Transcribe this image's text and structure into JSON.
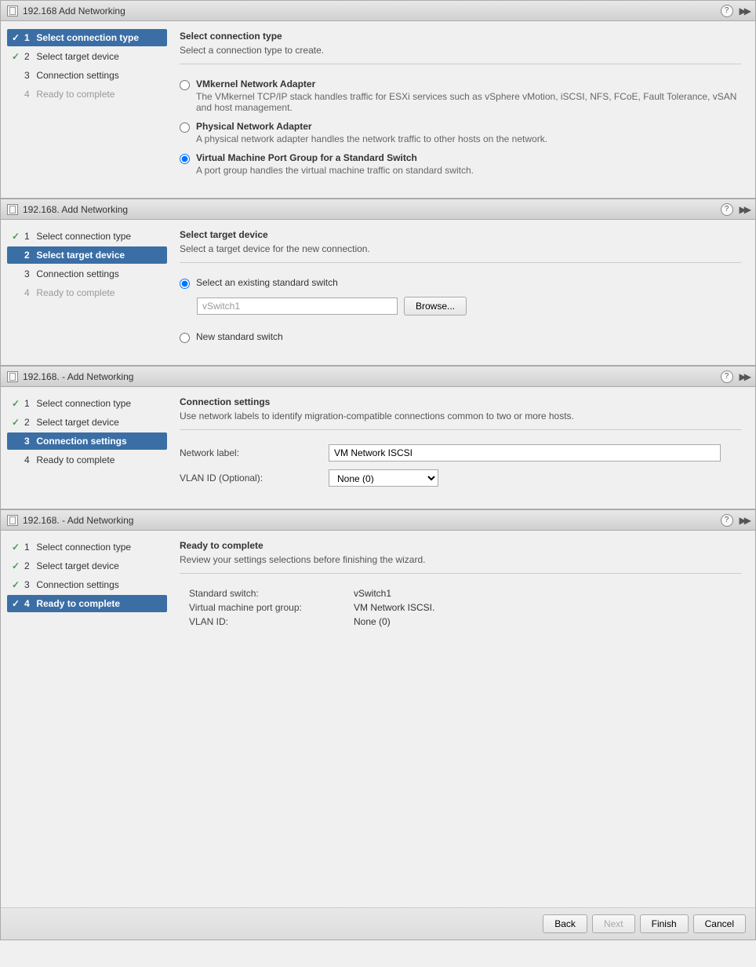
{
  "panels": [
    {
      "title": "192.168        Add Networking",
      "steps": {
        "s1": {
          "num": "1",
          "label": "Select connection type",
          "checked": true,
          "active": true
        },
        "s2": {
          "num": "2",
          "label": "Select target device",
          "checked": true,
          "active": false
        },
        "s3": {
          "num": "3",
          "label": "Connection settings",
          "checked": false,
          "active": false
        },
        "s4": {
          "num": "4",
          "label": "Ready to complete",
          "checked": false,
          "active": false,
          "dim": true
        }
      },
      "header": "Select connection type",
      "sub": "Select a connection type to create.",
      "options": {
        "o1": {
          "title": "VMkernel Network Adapter",
          "desc": "The VMkernel TCP/IP stack handles traffic for ESXi services such as vSphere vMotion, iSCSI, NFS, FCoE, Fault Tolerance, vSAN and host management."
        },
        "o2": {
          "title": "Physical Network Adapter",
          "desc": "A physical network adapter handles the network traffic to other hosts on the network."
        },
        "o3": {
          "title": "Virtual Machine Port Group for a Standard Switch",
          "desc": "A port group handles the virtual machine traffic on standard switch."
        }
      }
    },
    {
      "title": "192.168.        Add Networking",
      "steps": {
        "s1": {
          "num": "1",
          "label": "Select connection type",
          "checked": true
        },
        "s2": {
          "num": "2",
          "label": "Select target device",
          "active": true
        },
        "s3": {
          "num": "3",
          "label": "Connection settings"
        },
        "s4": {
          "num": "4",
          "label": "Ready to complete",
          "dim": true
        }
      },
      "header": "Select target device",
      "sub": "Select a target device for the new connection.",
      "options": {
        "o1": {
          "title": "Select an existing standard switch"
        },
        "o2": {
          "title": "New standard switch"
        }
      },
      "switch_value": "vSwitch1",
      "browse": "Browse..."
    },
    {
      "title": "192.168.      - Add Networking",
      "steps": {
        "s1": {
          "num": "1",
          "label": "Select connection type",
          "checked": true
        },
        "s2": {
          "num": "2",
          "label": "Select target device",
          "checked": true
        },
        "s3": {
          "num": "3",
          "label": "Connection settings",
          "active": true
        },
        "s4": {
          "num": "4",
          "label": "Ready to complete"
        }
      },
      "header": "Connection settings",
      "sub": "Use network labels to identify migration-compatible connections common to two or more hosts.",
      "form": {
        "label1": "Network label:",
        "value1": "VM Network ISCSI",
        "label2": "VLAN ID (Optional):",
        "value2": "None (0)"
      }
    },
    {
      "title": "192.168.       - Add Networking",
      "steps": {
        "s1": {
          "num": "1",
          "label": "Select connection type",
          "checked": true
        },
        "s2": {
          "num": "2",
          "label": "Select target device",
          "checked": true
        },
        "s3": {
          "num": "3",
          "label": "Connection settings",
          "checked": true
        },
        "s4": {
          "num": "4",
          "label": "Ready to complete",
          "checked": true,
          "active": true
        }
      },
      "header": "Ready to complete",
      "sub": "Review your settings selections before finishing the wizard.",
      "summary": {
        "l1": "Standard switch:",
        "v1": "vSwitch1",
        "l2": "Virtual machine port group:",
        "v2": "VM Network ISCSI.",
        "l3": "VLAN ID:",
        "v3": "None (0)"
      },
      "buttons": {
        "back": "Back",
        "next": "Next",
        "finish": "Finish",
        "cancel": "Cancel"
      }
    }
  ]
}
